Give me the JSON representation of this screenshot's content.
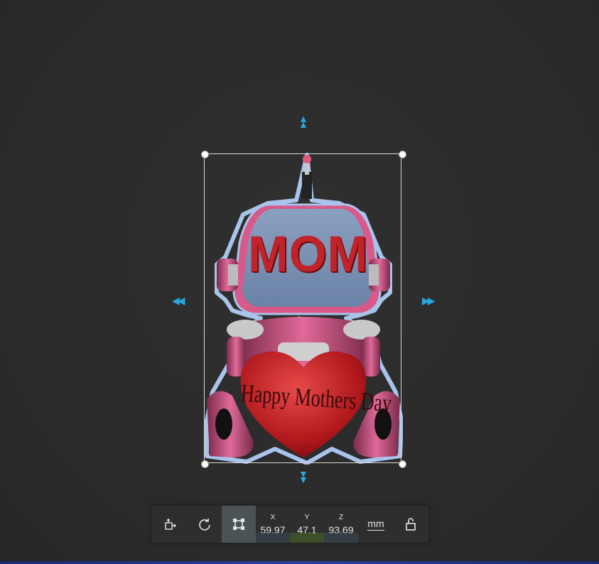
{
  "model": {
    "top_text": "MOM",
    "heart_text": "Happy Mothers Day"
  },
  "toolbar": {
    "x_label": "X",
    "y_label": "Y",
    "z_label": "Z",
    "x_value": "59.97",
    "y_value": "47.1",
    "z_value": "93.69",
    "unit": "mm"
  },
  "colors": {
    "accent_arrow": "#29a8e0",
    "x_bar": "#3a4a5a",
    "y_bar": "#4a6a2a",
    "z_bar": "#3a4a5a"
  },
  "icons": {
    "move": "move-icon",
    "rotate": "rotate-icon",
    "scale": "scale-icon",
    "lock": "lock-icon"
  }
}
